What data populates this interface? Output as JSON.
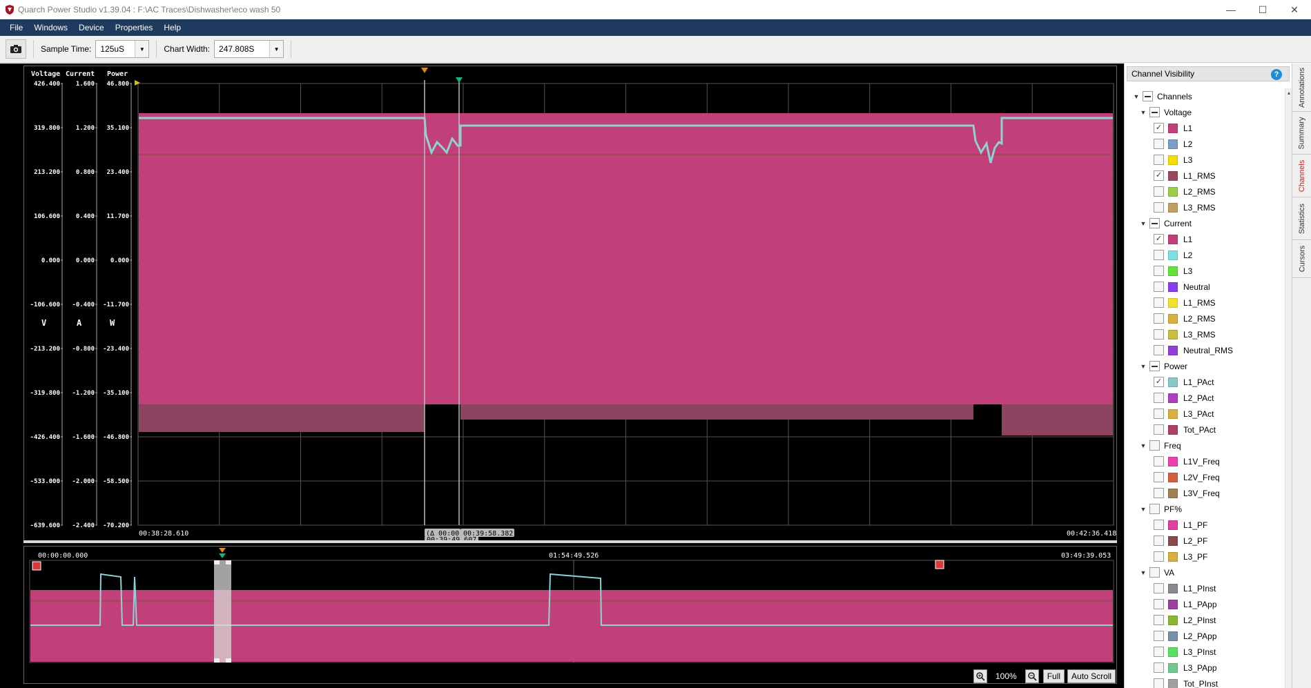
{
  "window": {
    "title": "Quarch Power Studio v1.39.04 : F:\\AC Traces\\Dishwasher\\eco wash 50",
    "minimize": "—",
    "maximize": "☐",
    "close": "✕"
  },
  "menu": [
    "File",
    "Windows",
    "Device",
    "Properties",
    "Help"
  ],
  "toolbar": {
    "sample_time_label": "Sample Time:",
    "sample_time_value": "125uS",
    "chart_width_label": "Chart Width:",
    "chart_width_value": "247.808S"
  },
  "top_chart": {
    "headers": {
      "voltage": "Voltage",
      "current": "Current",
      "power": "Power"
    },
    "voltage_ticks": [
      "426.400",
      "319.800",
      "213.200",
      "106.600",
      "0.000",
      "-106.600",
      "-213.200",
      "-319.800",
      "-426.400",
      "-533.000",
      "-639.600"
    ],
    "current_ticks": [
      "1.600",
      "1.200",
      "0.800",
      "0.400",
      "0.000",
      "-0.400",
      "-0.800",
      "-1.200",
      "-1.600",
      "-2.000",
      "-2.400"
    ],
    "power_ticks": [
      "46.800",
      "35.100",
      "23.400",
      "11.700",
      "0.000",
      "-11.700",
      "-23.400",
      "-35.100",
      "-46.800",
      "-58.500",
      "-70.200"
    ],
    "unit_v": "V",
    "unit_a": "A",
    "unit_w": "W",
    "time_start": "00:38:28.610",
    "time_end": "00:42:36.418",
    "cursor_delta": "(Δ 00:00:08.775)",
    "cursor_b_time": "00:39:58.382",
    "cursor_a_time": "00:39:49.607"
  },
  "bottom_chart": {
    "time_start": "00:00:00.000",
    "time_mid": "01:54:49.526",
    "time_end": "03:49:39.053"
  },
  "bottom_controls": {
    "zoom_pct": "100%",
    "full_label": "Full",
    "autoscroll_label": "Auto Scroll"
  },
  "panel": {
    "title": "Channel Visibility",
    "help": "?",
    "tree": [
      {
        "level": 0,
        "label": "Channels",
        "state": "partial",
        "expanded": true
      },
      {
        "level": 1,
        "label": "Voltage",
        "state": "partial",
        "expanded": true
      },
      {
        "level": 2,
        "label": "L1",
        "state": "checked",
        "color": "#c2407a"
      },
      {
        "level": 2,
        "label": "L2",
        "state": "empty",
        "color": "#7d9ec6"
      },
      {
        "level": 2,
        "label": "L3",
        "state": "empty",
        "color": "#f2e000"
      },
      {
        "level": 2,
        "label": "L1_RMS",
        "state": "checked",
        "color": "#9b4a5c"
      },
      {
        "level": 2,
        "label": "L2_RMS",
        "state": "empty",
        "color": "#9ccc4a"
      },
      {
        "level": 2,
        "label": "L3_RMS",
        "state": "empty",
        "color": "#c0a060"
      },
      {
        "level": 1,
        "label": "Current",
        "state": "partial",
        "expanded": true
      },
      {
        "level": 2,
        "label": "L1",
        "state": "checked",
        "color": "#c2407a"
      },
      {
        "level": 2,
        "label": "L2",
        "state": "empty",
        "color": "#7ee0e0"
      },
      {
        "level": 2,
        "label": "L3",
        "state": "empty",
        "color": "#66e03a"
      },
      {
        "level": 2,
        "label": "Neutral",
        "state": "empty",
        "color": "#8a3cf0"
      },
      {
        "level": 2,
        "label": "L1_RMS",
        "state": "empty",
        "color": "#f2e030"
      },
      {
        "level": 2,
        "label": "L2_RMS",
        "state": "empty",
        "color": "#d8b040"
      },
      {
        "level": 2,
        "label": "L3_RMS",
        "state": "empty",
        "color": "#c8c040"
      },
      {
        "level": 2,
        "label": "Neutral_RMS",
        "state": "empty",
        "color": "#9040d8"
      },
      {
        "level": 1,
        "label": "Power",
        "state": "partial",
        "expanded": true
      },
      {
        "level": 2,
        "label": "L1_PAct",
        "state": "checked",
        "color": "#88c8c8"
      },
      {
        "level": 2,
        "label": "L2_PAct",
        "state": "empty",
        "color": "#b040c0"
      },
      {
        "level": 2,
        "label": "L3_PAct",
        "state": "empty",
        "color": "#d8b040"
      },
      {
        "level": 2,
        "label": "Tot_PAct",
        "state": "empty",
        "color": "#b04060"
      },
      {
        "level": 1,
        "label": "Freq",
        "state": "empty",
        "expanded": true
      },
      {
        "level": 2,
        "label": "L1V_Freq",
        "state": "empty",
        "color": "#f040b0"
      },
      {
        "level": 2,
        "label": "L2V_Freq",
        "state": "empty",
        "color": "#d06040"
      },
      {
        "level": 2,
        "label": "L3V_Freq",
        "state": "empty",
        "color": "#a08050"
      },
      {
        "level": 1,
        "label": "PF%",
        "state": "empty",
        "expanded": true
      },
      {
        "level": 2,
        "label": "L1_PF",
        "state": "empty",
        "color": "#e040a0"
      },
      {
        "level": 2,
        "label": "L2_PF",
        "state": "empty",
        "color": "#8a4848"
      },
      {
        "level": 2,
        "label": "L3_PF",
        "state": "empty",
        "color": "#d8b040"
      },
      {
        "level": 1,
        "label": "VA",
        "state": "empty",
        "expanded": true
      },
      {
        "level": 2,
        "label": "L1_PInst",
        "state": "empty",
        "color": "#888890"
      },
      {
        "level": 2,
        "label": "L1_PApp",
        "state": "empty",
        "color": "#9a40a0"
      },
      {
        "level": 2,
        "label": "L2_PInst",
        "state": "empty",
        "color": "#8ab830"
      },
      {
        "level": 2,
        "label": "L2_PApp",
        "state": "empty",
        "color": "#7890a8"
      },
      {
        "level": 2,
        "label": "L3_PInst",
        "state": "empty",
        "color": "#58e060"
      },
      {
        "level": 2,
        "label": "L3_PApp",
        "state": "empty",
        "color": "#70c890"
      },
      {
        "level": 2,
        "label": "Tot_PInst",
        "state": "empty",
        "color": "#a0a0a0"
      }
    ]
  },
  "vtabs": [
    "Annotations",
    "Summary",
    "Channels",
    "Statistics",
    "Cursors"
  ],
  "colors": {
    "trace_pink": "#c2407a",
    "trace_rms": "#9b4a5c",
    "trace_cyan": "#8fd2d6",
    "cursor_orange": "#e08a1e",
    "cursor_green": "#1fae7a",
    "marker_red": "#d83a3a"
  }
}
